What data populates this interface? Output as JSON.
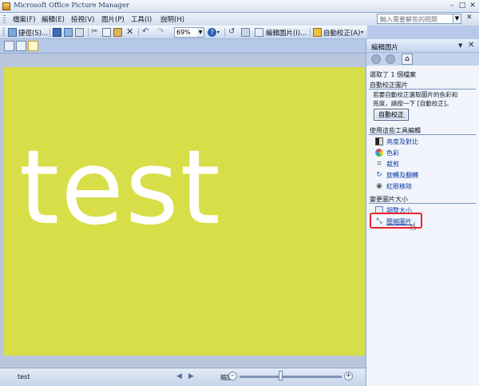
{
  "window": {
    "title": "Microsoft Office Picture Manager"
  },
  "menu": {
    "items": [
      "檔案(F)",
      "編輯(E)",
      "檢視(V)",
      "圖片(P)",
      "工具(I)",
      "說明(H)"
    ],
    "help_search_placeholder": "輸入需要解答的問題"
  },
  "toolbar": {
    "shortcuts_label": "捷徑(S)...",
    "zoom_value": "69%",
    "edit_pictures_label": "編輯圖片(I)...",
    "auto_correct_label": "自動校正(A)"
  },
  "picture": {
    "text": "test",
    "background_color": "#d8de48",
    "text_color": "#ffffff"
  },
  "status": {
    "filename": "test",
    "zoom_label": "縮放:",
    "zoom_level": 0.4
  },
  "panel": {
    "title": "編輯圖片",
    "selection_info": "選取了 1 個檔案",
    "auto_correct_section": "自動校正圖片",
    "auto_correct_description": "若要自動校正選取圖片的色彩和\n亮度，請按一下 [自動校正]。",
    "auto_correct_button": "自動校正",
    "tools_section": "使用這些工具編輯",
    "tools": [
      {
        "label": "亮度及對比",
        "icon": "brightness-icon"
      },
      {
        "label": "色彩",
        "icon": "color-icon"
      },
      {
        "label": "裁剪",
        "icon": "crop-icon"
      },
      {
        "label": "旋轉及翻轉",
        "icon": "rotate-icon"
      },
      {
        "label": "紅眼移除",
        "icon": "red-eye-icon"
      }
    ],
    "resize_section": "變更圖片大小",
    "resize_items": [
      {
        "label": "調整大小",
        "icon": "resize-icon"
      },
      {
        "label": "壓縮圖片",
        "icon": "compress-icon"
      }
    ]
  },
  "colors": {
    "highlight": "#e8242a",
    "link": "#0b3aa0",
    "canvas": "#b9c6dc"
  }
}
